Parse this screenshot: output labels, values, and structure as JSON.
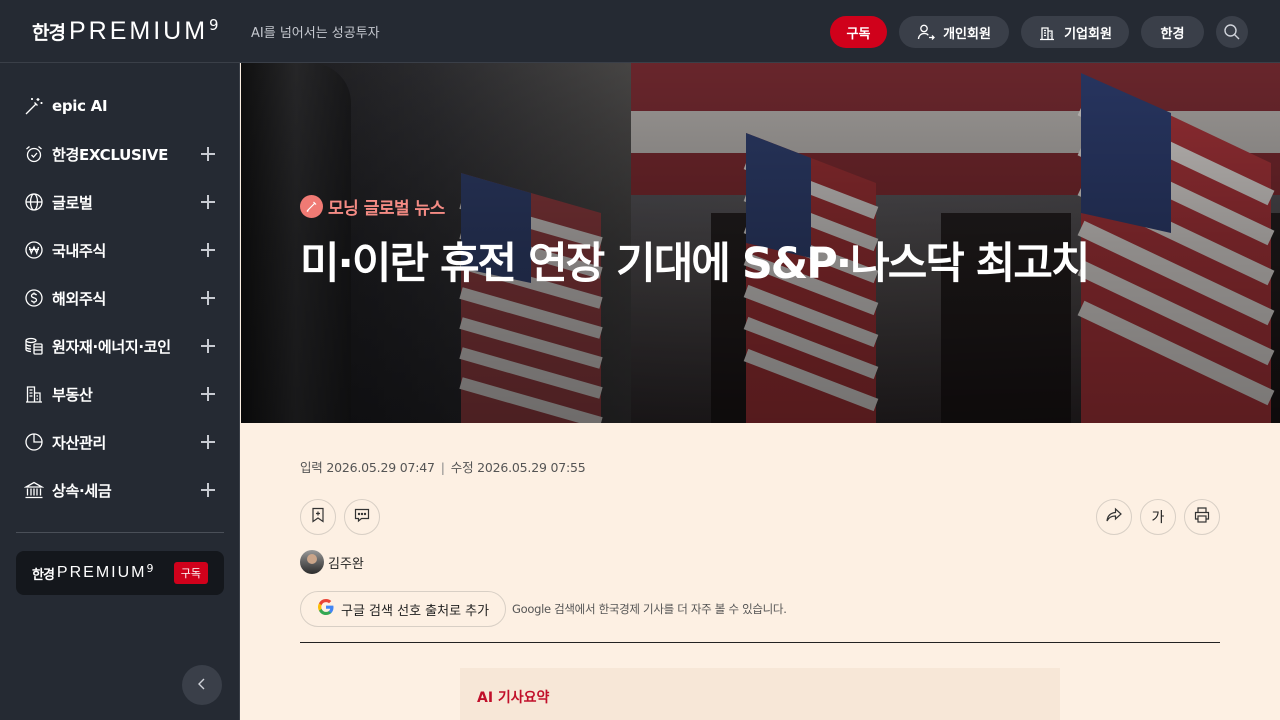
{
  "header": {
    "logo_kr": "한경",
    "logo_en": "PREMIUM",
    "logo_sup": "9",
    "tagline": "AI를 넘어서는 성공투자",
    "subscribe_label": "구독",
    "personal_label": "개인회원",
    "corporate_label": "기업회원",
    "hk_label": "한경"
  },
  "sidebar": {
    "items": [
      {
        "label": "epic AI",
        "icon": "magic-wand-icon",
        "expandable": false
      },
      {
        "label": "한경EXCLUSIVE",
        "icon": "alarm-clock-icon",
        "expandable": true
      },
      {
        "label": "글로벌",
        "icon": "globe-icon",
        "expandable": true
      },
      {
        "label": "국내주식",
        "icon": "won-coin-icon",
        "expandable": true
      },
      {
        "label": "해외주식",
        "icon": "dollar-coin-icon",
        "expandable": true
      },
      {
        "label": "원자재·에너지·코인",
        "icon": "coins-stack-icon",
        "expandable": true
      },
      {
        "label": "부동산",
        "icon": "building-icon",
        "expandable": true
      },
      {
        "label": "자산관리",
        "icon": "pie-chart-icon",
        "expandable": true
      },
      {
        "label": "상속·세금",
        "icon": "bank-icon",
        "expandable": true
      }
    ],
    "promo": {
      "logo_kr": "한경",
      "logo_en": "PREMIUM",
      "logo_sup": "9",
      "button_label": "구독"
    }
  },
  "article": {
    "category": "모닝 글로벌 뉴스",
    "title": "미·이란 휴전 연장 기대에 S&P·나스닥 최고치",
    "published": "입력 2026.05.29 07:47",
    "separator": "|",
    "modified": "수정 2026.05.29 07:55",
    "font_button_label": "가",
    "author": "김주완",
    "google_button_label": "구글 검색 선호 출처로 추가",
    "google_note": "Google 검색에서 한국경제 기사를 더 자주 볼 수 있습니다.",
    "summary_title": "AI 기사요약"
  },
  "colors": {
    "header_bg": "#252a33",
    "accent_red": "#d0011b",
    "category_pink": "#f48b84",
    "content_bg": "#fdf0e3",
    "summary_bg": "#f7e7d7"
  }
}
